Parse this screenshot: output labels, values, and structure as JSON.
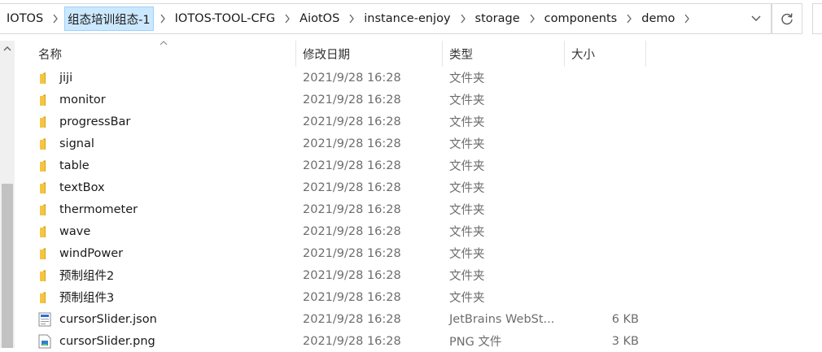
{
  "address_bar": {
    "crumbs": [
      "IOTOS",
      "组态培训组态-1",
      "IOTOS-TOOL-CFG",
      "AiotOS",
      "instance-enjoy",
      "storage",
      "components",
      "demo"
    ],
    "selected_index": 1
  },
  "columns": {
    "name": "名称",
    "date": "修改日期",
    "type": "类型",
    "size": "大小"
  },
  "files": [
    {
      "name": "jiji",
      "date": "2021/9/28 16:28",
      "type": "文件夹",
      "size": "",
      "icon": "folder-icon"
    },
    {
      "name": "monitor",
      "date": "2021/9/28 16:28",
      "type": "文件夹",
      "size": "",
      "icon": "folder-icon"
    },
    {
      "name": "progressBar",
      "date": "2021/9/28 16:28",
      "type": "文件夹",
      "size": "",
      "icon": "folder-icon"
    },
    {
      "name": "signal",
      "date": "2021/9/28 16:28",
      "type": "文件夹",
      "size": "",
      "icon": "folder-icon"
    },
    {
      "name": "table",
      "date": "2021/9/28 16:28",
      "type": "文件夹",
      "size": "",
      "icon": "folder-icon"
    },
    {
      "name": "textBox",
      "date": "2021/9/28 16:28",
      "type": "文件夹",
      "size": "",
      "icon": "folder-icon"
    },
    {
      "name": "thermometer",
      "date": "2021/9/28 16:28",
      "type": "文件夹",
      "size": "",
      "icon": "folder-icon"
    },
    {
      "name": "wave",
      "date": "2021/9/28 16:28",
      "type": "文件夹",
      "size": "",
      "icon": "folder-icon"
    },
    {
      "name": "windPower",
      "date": "2021/9/28 16:28",
      "type": "文件夹",
      "size": "",
      "icon": "folder-icon"
    },
    {
      "name": "预制组件2",
      "date": "2021/9/28 16:28",
      "type": "文件夹",
      "size": "",
      "icon": "folder-icon"
    },
    {
      "name": "预制组件3",
      "date": "2021/9/28 16:28",
      "type": "文件夹",
      "size": "",
      "icon": "folder-icon"
    },
    {
      "name": "cursorSlider.json",
      "date": "2021/9/28 16:28",
      "type": "JetBrains WebSt...",
      "size": "6 KB",
      "icon": "json-file-icon"
    },
    {
      "name": "cursorSlider.png",
      "date": "2021/9/28 16:28",
      "type": "PNG 文件",
      "size": "3 KB",
      "icon": "png-file-icon"
    }
  ],
  "colors": {
    "folder": "#f5c542",
    "selection": "#cce8ff",
    "selection_border": "#99d1ff"
  }
}
